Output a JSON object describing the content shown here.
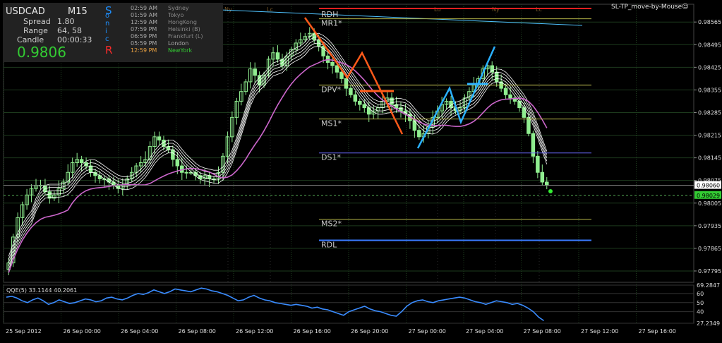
{
  "colors": {
    "background": "#000000",
    "grid": "#1d3a1d",
    "bull": "#90ee90",
    "ma_white": "#ffffff",
    "ma_violet": "#cc66cc",
    "resistance": "#e02020",
    "support": "#3a7bff",
    "pivot": "#d8d85a",
    "mid": "#b8b84a",
    "s1": "#6a6aff",
    "trend_red": "#ff5a1a",
    "trend_blue": "#2ab0ff",
    "qqe": "#3a8cff",
    "sonic_blue": "#1e90ff",
    "sonic_red": "#ff2a2a",
    "price_green": "#33cc33"
  },
  "panel": {
    "symbol": "USDCAD",
    "timeframe": "M15",
    "spread_label": "Spread",
    "spread_value": "1.80",
    "range_label": "Range",
    "range_value": "64, 58",
    "candle_label": "Candle",
    "candle_value": "00:00:33",
    "price": "0.9806",
    "sonic_letters": [
      "S",
      "o",
      "n",
      "i",
      "c"
    ],
    "sonic_r": "R",
    "cities": [
      {
        "time": "02:59 AM",
        "name": "Sydney"
      },
      {
        "time": "01:59 AM",
        "name": "Tokyo"
      },
      {
        "time": "12:59 AM",
        "name": "HongKong"
      },
      {
        "time": "07:59 PM",
        "name": "Helsinki  (B)"
      },
      {
        "time": "06:59 PM",
        "name": "Frankfurt  (L)"
      },
      {
        "time": "05:59 PM",
        "name": "London"
      },
      {
        "time": "12:59 PM",
        "name": "NewYork"
      }
    ]
  },
  "mouse_label": "SL-TP_move-by-Mouse☺",
  "chart_data": {
    "type": "candlestick",
    "symbol": "USDCAD",
    "timeframe": "M15",
    "y_ticks": [
      "0.98565",
      "0.98495",
      "0.98425",
      "0.98355",
      "0.98285",
      "0.98215",
      "0.98145",
      "0.98075",
      "0.98005",
      "0.97935",
      "0.97865",
      "0.97795"
    ],
    "current_price_tags": [
      "0.98060",
      "0.98029"
    ],
    "x_ticks": [
      "25 Sep 2012",
      "26 Sep 00:00",
      "26 Sep 04:00",
      "26 Sep 08:00",
      "26 Sep 12:00",
      "26 Sep 16:00",
      "26 Sep 20:00",
      "27 Sep 00:00",
      "27 Sep 04:00",
      "27 Sep 08:00",
      "27 Sep 12:00",
      "27 Sep 16:00"
    ],
    "session_markers": [
      "Ny",
      "Lc",
      "Lu",
      "Ny",
      "Lc"
    ],
    "levels": [
      {
        "label": "RDH",
        "value": 0.98607,
        "color": "#e02020"
      },
      {
        "label": "MR1*",
        "value": 0.98575,
        "color": "#b8b84a"
      },
      {
        "label": "DPV*",
        "value": 0.9837,
        "color": "#d8d85a"
      },
      {
        "label": "MS1*",
        "value": 0.98265,
        "color": "#b8b84a"
      },
      {
        "label": "DS1*",
        "value": 0.9816,
        "color": "#6a6aff"
      },
      {
        "label": "MS2*",
        "value": 0.97955,
        "color": "#b8b84a"
      },
      {
        "label": "RDL",
        "value": 0.9789,
        "color": "#3a7bff"
      }
    ],
    "close_path": [
      0.9782,
      0.979,
      0.9796,
      0.98,
      0.9803,
      0.9805,
      0.9806,
      0.9806,
      0.9804,
      0.9802,
      0.9803,
      0.9805,
      0.9807,
      0.981,
      0.9813,
      0.9814,
      0.9813,
      0.9812,
      0.981,
      0.9809,
      0.9808,
      0.9808,
      0.9807,
      0.9806,
      0.9805,
      0.9806,
      0.9808,
      0.981,
      0.9812,
      0.9813,
      0.9814,
      0.9818,
      0.9821,
      0.982,
      0.9818,
      0.9817,
      0.9814,
      0.9812,
      0.981,
      0.981,
      0.981,
      0.9809,
      0.9808,
      0.9809,
      0.9808,
      0.9808,
      0.981,
      0.9815,
      0.9821,
      0.9827,
      0.9832,
      0.9835,
      0.9838,
      0.9842,
      0.984,
      0.9837,
      0.984,
      0.9845,
      0.9847,
      0.9845,
      0.9843,
      0.9846,
      0.9848,
      0.985,
      0.9851,
      0.9852,
      0.9853,
      0.9851,
      0.9849,
      0.9846,
      0.9844,
      0.9843,
      0.9841,
      0.9839,
      0.9836,
      0.9834,
      0.9832,
      0.9831,
      0.983,
      0.9828,
      0.9829,
      0.983,
      0.9832,
      0.9833,
      0.9831,
      0.983,
      0.9829,
      0.9828,
      0.9826,
      0.9823,
      0.9821,
      0.9822,
      0.9824,
      0.9827,
      0.9829,
      0.9831,
      0.9832,
      0.983,
      0.9829,
      0.983,
      0.9833,
      0.9835,
      0.9837,
      0.9839,
      0.9842,
      0.9843,
      0.9841,
      0.9838,
      0.9836,
      0.9834,
      0.9833,
      0.9832,
      0.983,
      0.9827,
      0.9822,
      0.9815,
      0.981,
      0.9807,
      0.9806
    ],
    "qqe": {
      "label": "QQE(5) 33.1144 40.2061",
      "ticks": [
        "69.2847",
        "60",
        "50",
        "40",
        "27.2349"
      ],
      "path": [
        56,
        57,
        55,
        52,
        50,
        53,
        55,
        52,
        48,
        50,
        53,
        51,
        49,
        50,
        52,
        54,
        53,
        51,
        52,
        55,
        56,
        54,
        53,
        55,
        58,
        60,
        59,
        61,
        64,
        62,
        60,
        62,
        65,
        64,
        63,
        62,
        64,
        66,
        65,
        63,
        62,
        60,
        58,
        55,
        52,
        53,
        56,
        58,
        55,
        53,
        52,
        50,
        49,
        48,
        47,
        48,
        47,
        46,
        44,
        45,
        43,
        42,
        40,
        38,
        36,
        40,
        42,
        44,
        46,
        43,
        41,
        40,
        38,
        36,
        35,
        40,
        46,
        50,
        52,
        53,
        51,
        50,
        52,
        53,
        54,
        55,
        56,
        55,
        53,
        51,
        50,
        48,
        50,
        52,
        51,
        50,
        48,
        49,
        47,
        44,
        40,
        34,
        30
      ]
    }
  }
}
